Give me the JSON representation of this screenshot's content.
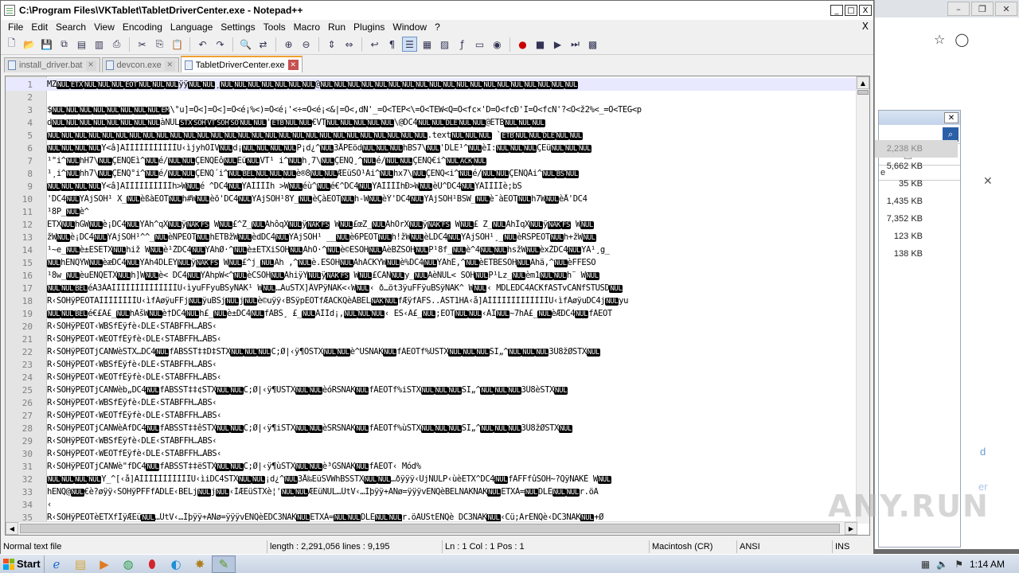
{
  "window": {
    "title": "C:\\Program Files\\VKTablet\\TabletDriverCenter.exe - Notepad++",
    "minimize": "_",
    "maximize": "□",
    "close": "X"
  },
  "menu": [
    "File",
    "Edit",
    "Search",
    "View",
    "Encoding",
    "Language",
    "Settings",
    "Tools",
    "Macro",
    "Run",
    "Plugins",
    "Window",
    "?"
  ],
  "menu_close": "X",
  "tabs": [
    {
      "label": "install_driver.bat",
      "active": false
    },
    {
      "label": "devcon.exe",
      "active": false
    },
    {
      "label": "TabletDriverCenter.exe",
      "active": true
    }
  ],
  "editor": {
    "lines": [
      {
        "n": "1",
        "text": "MZ[NUL][ETX][NUL][NUL][NUL][EOT][NUL][NUL][NUL]ÿÿ[NUL][NUL]¸[NUL][NUL][NUL][NUL][NUL][NUL][NUL]@[NUL][NUL][NUL][NUL][NUL][NUL][NUL][NUL][NUL][NUL][NUL][NUL][NUL][NUL][NUL][NUL][NUL][NUL][NUL]"
      },
      {
        "n": "2",
        "text": ""
      },
      {
        "n": "3",
        "text": "$[NUL][NUL][NUL][NUL][NUL][NUL][NUL][NUL][EM]\\°u]=Ô<]=Ô<]=Ô<é¡%<)=Ô<é¡'<÷=Ô<é¡<&|=Ô<,dÑ'_=Ô<TEP<\\=Ô<TEW<Q=Ô<fc×'D=Ô<fcÐ'I=Ô<fcÑ'?<Ô<ž2%<_=Ô<TEG<p"
      },
      {
        "n": "4",
        "text": "d[NUL][NUL][NUL][NUL][NUL][NUL][NUL][NUL]àNUL[STX][SOH][VT][SOH][SO][NUL][NUL]'[ETB][NUL][NUL]€VT[NUL][NUL][NUL][NUL][NUL]\\@DC4[NUL][NUL][DLE][NUL][NUL]@ETB[NUL][NUL][NUL]"
      },
      {
        "n": "5",
        "text": "[NUL][NUL][NUL][NUL][NUL][NUL][NUL][NUL][NUL][NUL][NUL][NUL][NUL][NUL][NUL][NUL][NUL][NUL][NUL][NUL][NUL][NUL][NUL][NUL][NUL][NUL][NUL][NUL].text[NUL][NUL][NUL] `[ETB][NUL][NUL][DLE][NUL][NUL]"
      },
      {
        "n": "6",
        "text": "[NUL][NUL][NUL][NUL]Y<â]ÃÌÌÌÌÌÌÌÌÌÌÌU‹ìjyhÔÏV[NUL]d¡[NUL][NUL][NUL][NUL]P¡d¿^[NUL]3ÅPEöd[NUL][NUL][NUL]hBS7\\[NUL]'DLE¹^[NUL]èI:[NUL][NUL][NUL]ÇEü[NUL][NUL][NUL]"
      },
      {
        "n": "7",
        "text": "¹\"i^[NUL]hH7\\[NUL]ÇENQEì^[NUL]é/[NUL][NUL]ÇENQEô[NUL]Eü[NUL]VT¹ i^[NUL]h¸7\\[NUL]ÇENQ¸^[NUL]é/[NUL][NUL]ÇENQ€i^[NUL][ACK][NUL]"
      },
      {
        "n": "8",
        "text": "¹¸i^[NUL]hh7\\[NUL]ÇENQ°i^[NUL]é/[NUL][NUL]ÇENQ´i^[NUL][BEL][NUL][NUL][NUL]è®8[NUL][NUL]ÆEüSO¹Äi^[NUL]hx7\\[NUL]ÇENQ<i^[NUL]é/[NUL][NUL]ÇENQÀi^[NUL][BS][NUL]"
      },
      {
        "n": "9",
        "text": "[NUL][NUL][NUL][NUL]Y<â]ÃÌÌÌÌÌÌÌÌÌÌh>W[NUL]é     ^DC4[NUL]YÃÌÌÌÌh >W[NUL]éù^[NUL]é€^DC4[NUL]YÃÌÌÌÌhÐ>W[NUL]èÙ^DC4[NUL]YÃÌÌÌÌè;bS"
      },
      {
        "n": "10",
        "text": "'DC4[NUL]YÃjSOH¹ X_[NUL]èßàEOT[NUL]h#W[NUL]èõ'DC4[NUL]YÃjSOH¹8Y_[NUL]èÇàEOT[NUL]h-W[NUL]èÝ'DC4[NUL]YÃjSOH¹BSW_[NUL]è¯àEOT[NUL]h7W[NUL]èÅ'DC4"
      },
      {
        "n": "11",
        "text": "¹8P_[NUL]è^"
      },
      {
        "n": "12",
        "text": "ETX[NUL]hGW[NUL]è¡DC4[NUL]YÃh^qX[NUL]ÿ[NAK][FS] W[NUL]£^Z_[NUL]ÃhôqX[NUL]ÿ[NAK][FS] W[NUL]£œZ_[NUL]ÃhOrX[NUL]ÿ[NAK][FS] W[NUL]£ Z_[NUL]ÃhÌqX[NUL]ÿ[NAK][FS] W[NUL]"
      },
      {
        "n": "13",
        "text": "žW[NUL]è¡DC4[NUL]YÃjSOH¹^^_[NUL]èNPEOT[NUL]hETBžW[NUL]èdDC4[NUL]YÃjSOH¹ __[NUL]è6PEOT[NUL]h!žW[NUL]èLDC4[NUL]YÃjSOH¹¸_[NUL]èRSPEOT[NUL]h+žW[NUL]"
      },
      {
        "n": "14",
        "text": "¹~e_[NUL]è±ESETX[NUL]hiž W[NUL]è¹ŽDC4[NUL]YÃhØ·^[NUL]è±ETXiSOH[NUL]ÃhÒ·^[NUL]è©ESOH[NUL]ÃèBŽSOH[NUL]P¹8f_[NUL]è^4[NUL][NUL]hsžW[NUL]èxŽDC4[NUL]YÃ¹¸g_"
      },
      {
        "n": "15",
        "text": "[NUL]hENQŸW[NUL]èæDC4[NUL]YÃh4DLEY[NUL]ÿ[NAK][FS] W[NUL]£^j_[NUL]Ãh ,^[NUL]è.ESOH[NUL]ÃhACKŸW[NUL]è%DC4[NUL]YÃhË,^[NUL]èETBESOH[NUL]Ãhä,^[NUL]èFFESO"
      },
      {
        "n": "16",
        "text": "¹8w_[NUL]èuENQETX[NUL]h]W[NUL]è< DC4[NUL]YÃhpW<^[NUL]èCSOH[NUL]ÃhiÿY[NUL]ÿ[NAK][FS] W[NUL]£CAN[NUL]y_[NUL]ÃèNUL< SOH[NUL]P¹Lz_[NUL]èm1[NUL][NUL]h¨ W[NUL]"
      },
      {
        "n": "17",
        "text": "[NUL][NUL][BEL]éÃ3ÀÃÌÌÌÌÌÌÌÌÌÌÌÌÌÌU‹ìyuFFyuBSyNAK¹ W[NUL]…ÄuSTX]ÂVPÿNAK<‹W[NUL]‹ ð…öt3ÿuFFÿuBSÿNAK^ W[NUL]‹ MDLEDC4ACKfASTvCANfSTUSD[NUL]"
      },
      {
        "n": "18",
        "text": "R‹SOHÿPEOTÃÌÌÌÌÌÌÌÌU‹ìfÄøÿuFFj[NUL]ÿuBSj[NUL]j[NUL]è©uÿÿ‹BSÿpEOTfÆACKQèÀBEL[NAK][NUL]fÆÿfÄFS..ÀST1HÄ‹å]ÃÌÌÌÌÌÌÌÌÌÌÌÌÌU‹ìfÄøÿuDC4j[NUL]yu"
      },
      {
        "n": "19",
        "text": "[NUL][NUL][BEL]é€£Ä£_[NUL]hÄšW[NUL]è†DC4[NUL]h£_[NUL]è±DC4[NUL]fÄBS¸ £_[NUL]ÃÌÍd¡,[NUL][NUL][NUL]‹ ES‹Ä£_[NUL];EOT[NUL][NUL]‹ÀÌ[NUL]~7hÄ£_[NUL]èÆDC4[NUL]fÄEOT"
      },
      {
        "n": "20",
        "text": "R‹SOHÿPEOT‹WBSfÈÿfè‹DLE‹STÀBFFH…ÀBS‹"
      },
      {
        "n": "21",
        "text": "R‹SOHÿPEOT‹WEOTfÈÿfè‹DLE‹STÀBFFH…ÀBS‹"
      },
      {
        "n": "22",
        "text": "R‹SOHÿPEOTjCANWèSTX…DC4[NUL]fÄBSST‡‡D‡STX[NUL][NUL][NUL]C;Ø|‹ÿ¶ÔSTX[NUL][NUL]è^USNAK[NUL]fÄEOTf%ÙSTX[NUL][NUL][NUL]SI„^[NUL][NUL][NUL]3Û8žØSTX[NUL]"
      },
      {
        "n": "23",
        "text": "R‹SOHÿPEOT‹WBSfÈÿfè‹DLE‹STÀBFFH…ÀBS‹"
      },
      {
        "n": "24",
        "text": "R‹SOHÿPEOT‹WEOTfÈÿfè‹DLE‹STÀBFFH…ÀBS‹"
      },
      {
        "n": "25",
        "text": "R‹SOHÿPEOTjCANWèb„DC4[NUL]fÄBSST‡‡¢STX[NUL][NUL]C;Ø|‹ÿ¶ÙSTX[NUL][NUL]èóRSNAK[NUL]fÄEOTf%iSTX[NUL][NUL][NUL]SI„^[NUL][NUL][NUL]3Û8èSTX[NUL]"
      },
      {
        "n": "26",
        "text": "R‹SOHÿPEOT‹WBSfÈÿfè‹DLE‹STÀBFFH…ÀBS‹"
      },
      {
        "n": "27",
        "text": "R‹SOHÿPEOT‹WEOTfÈÿfè‹DLE‹STÀBFFH…ÀBS‹"
      },
      {
        "n": "28",
        "text": "R‹SOHÿPEOTjCANWèÂfDC4[NUL]fÄBSST‡‡êSTX[NUL][NUL]C;Ø|‹ÿ¶iSTX[NUL][NUL]èSRSNAK[NUL]fÄEOTf%ùSTX[NUL][NUL][NUL]SI„^[NUL][NUL][NUL]3Û8žØSTX[NUL]"
      },
      {
        "n": "29",
        "text": "R‹SOHÿPEOT‹WBSfÈÿfè‹DLE‹STÀBFFH…ÀBS‹"
      },
      {
        "n": "30",
        "text": "R‹SOHÿPEOT‹WEOTfÈÿfè‹DLE‹STÀBFFH…ÀBS‹"
      },
      {
        "n": "31",
        "text": "R‹SOHÿPEOTjCANWè\"fDC4[NUL]fÄBSST‡‡ëSTX[NUL][NUL]C;Ø|‹ÿ¶ùSTX[NUL][NUL]è³GSNAK[NUL]fÄEOT‹ Mód%"
      },
      {
        "n": "32",
        "text": "[NUL][NUL][NUL][NUL]Y_^[‹å]ÃÌÌÌÌÌÌÌÌÌÌÌU‹ìiDC4STX[NUL][NUL]¡d¿^[NUL]3Å‰EüSVWhBSSTX[NUL][NUL]…ðÿÿÿ‹ÙjNULP‹ùèETX^DC4[NUL]fÄFFfûSOH~?QÿNAKÈ W[NUL]"
      },
      {
        "n": "33",
        "text": "hENQ@[NUL]€è?øÿÿ‹SOHÿPFFfÄDLE‹BELj[NUL]j[NUL]‹ÌÆEüSTXè¦'[NUL][NUL]ÆEüNUL…ÛtV‹…Ìþÿÿ+ÃÑø=ÿÿÿvENQèBELNAKNAK[NUL]ETXÀ=[NUL]DLE[NUL][NUL]r.öÃ"
      },
      {
        "n": "34",
        "text": "‹"
      },
      {
        "n": "35",
        "text": "R‹SOHÿPEOTèETXfÌÿÆEü[NUL]…ÛtV‹…Ìþÿÿ+ÃÑø=ÿÿÿvENQèÊDC3NAK[NUL]ETXÀ=[NUL][NUL]DLE[NUL][NUL]r.öÃUStENQè DC3NAK[NUL]‹Cü;ÃrENQè‹DC3NAK[NUL]+Ø"
      }
    ]
  },
  "status": {
    "type": "Normal text file",
    "length": "length : 2,291,056    lines : 9,195",
    "position": "Ln : 1    Col : 1    Pos : 1",
    "eol": "Macintosh (CR)",
    "encoding": "ANSI",
    "mode": "INS"
  },
  "background_window": {
    "sizes": [
      "2,238 KB",
      "5,662 KB",
      "35 KB",
      "1,435 KB",
      "7,352 KB",
      "123 KB",
      "138 KB"
    ],
    "column_header": "e",
    "link_text_1": "d",
    "link_text_2": "er"
  },
  "taskbar": {
    "start_label": "Start",
    "clock": "1:14 AM"
  },
  "watermark": "ANY.RUN",
  "colors": {
    "control_char_bg": "#000000",
    "tab_active_accent": "#f0a030",
    "taskbar_bg": "#c7d2e2"
  }
}
